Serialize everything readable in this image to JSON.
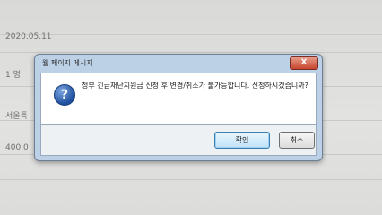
{
  "background": {
    "rows": [
      {
        "text": ""
      },
      {
        "text": "2020.05.11"
      },
      {
        "text": "1 명"
      },
      {
        "text": "서울특"
      },
      {
        "text": "400,0"
      }
    ]
  },
  "dialog": {
    "title": "웹 페이지 메시지",
    "close_label": "X",
    "icon": "question-icon",
    "message": "정부 긴급재난지원금 신청 후 변경/취소가 불가능합니다. 신청하시겠습니까?",
    "ok_label": "확인",
    "cancel_label": "취소"
  },
  "colors": {
    "dialog_frame": "#bcd0e6",
    "close_button": "#c7452d",
    "question_icon": "#1f4f9d"
  }
}
